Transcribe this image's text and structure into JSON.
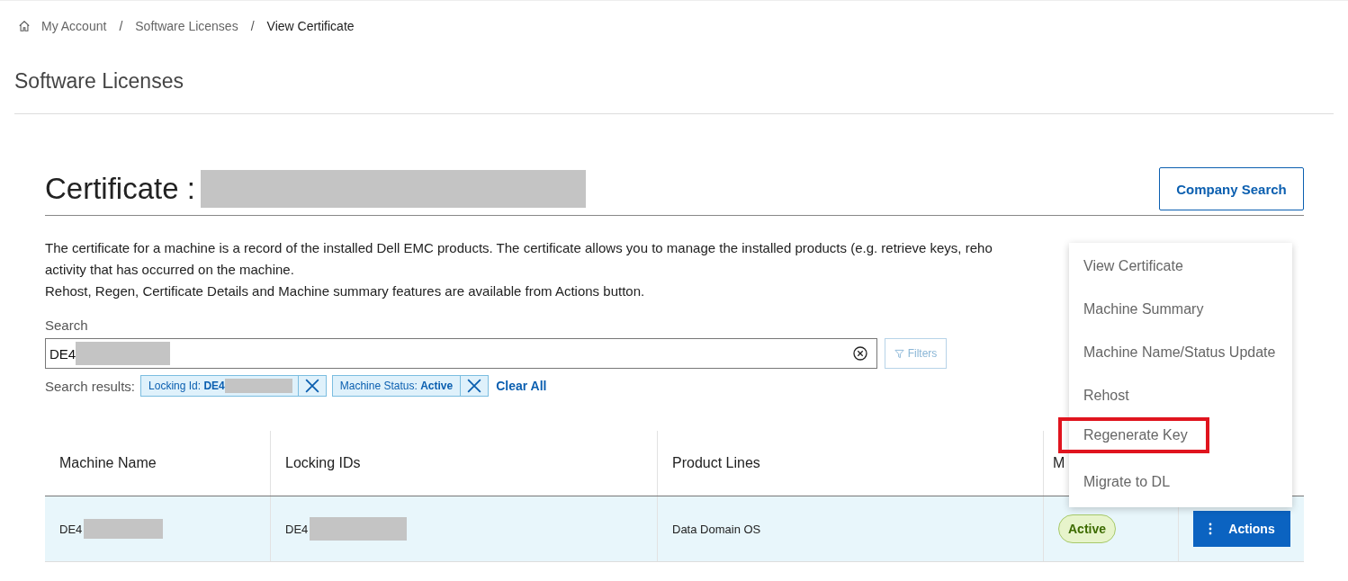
{
  "breadcrumb": {
    "separator": "/",
    "items": [
      {
        "label": "My Account",
        "current": false
      },
      {
        "label": "Software Licenses",
        "current": false
      },
      {
        "label": "View Certificate",
        "current": true
      }
    ]
  },
  "page_title": "Software Licenses",
  "certificate": {
    "label": "Certificate :",
    "value_redacted": true
  },
  "company_search_button": "Company Search",
  "description": [
    "The certificate for a machine is a record of the installed Dell EMC products. The certificate allows you to manage the installed products (e.g. retrieve keys, reho",
    "activity that has occurred on the machine.",
    "Rehost, Regen, Certificate Details and Machine summary features are available from Actions button."
  ],
  "search": {
    "label": "Search",
    "value": "DE4",
    "filters_button": "Filters"
  },
  "search_results": {
    "label": "Search results:",
    "chips": [
      {
        "key": "Locking Id:",
        "value": "DE4"
      },
      {
        "key": "Machine Status:",
        "value": "Active"
      }
    ],
    "clear_all": "Clear All"
  },
  "table": {
    "columns": [
      "Machine Name",
      "Locking IDs",
      "Product Lines",
      "M"
    ],
    "rows": [
      {
        "machine_name": "DE4",
        "locking_ids": "DE4",
        "product_lines": "Data Domain OS",
        "status": "Active",
        "actions": "Actions",
        "selected": true
      }
    ]
  },
  "actions_menu": {
    "items": [
      {
        "label": "View Certificate",
        "highlighted": false
      },
      {
        "label": "Machine Summary",
        "highlighted": false
      },
      {
        "label": "Machine Name/Status Update",
        "highlighted": false
      },
      {
        "label": "Rehost",
        "highlighted": false
      },
      {
        "label": "Regenerate Key",
        "highlighted": true
      },
      {
        "label": "Migrate to DL",
        "highlighted": false
      }
    ]
  }
}
